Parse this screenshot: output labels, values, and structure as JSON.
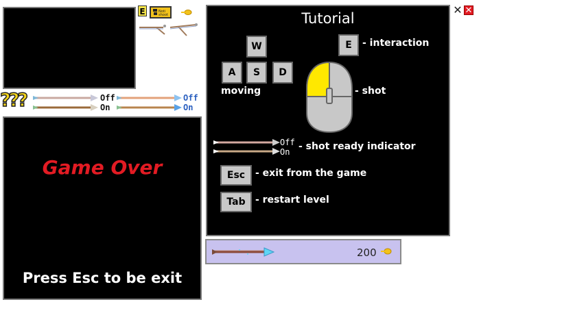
{
  "sprites": {
    "key_e": "E",
    "noti_sprite_text": "Noti\nshoot",
    "question_marks": "???",
    "indicator_labels": {
      "left_off": "Off",
      "left_on": "On",
      "right_off": "Off",
      "right_on": "On"
    }
  },
  "game_over": {
    "title": "Game Over",
    "hint": "Press Esc to be exit",
    "title_color": "#e21b23"
  },
  "tutorial": {
    "title": "Tutorial",
    "keys": {
      "w": "W",
      "a": "A",
      "s": "S",
      "d": "D",
      "e": "E",
      "esc": "Esc",
      "tab": "Tab"
    },
    "moving_label": "moving",
    "interaction_label": "- interaction",
    "shot_label": "- shot",
    "indicator_off": "Off",
    "indicator_on": "On",
    "indicator_label": "- shot ready indicator",
    "esc_label": "- exit from the game",
    "tab_label": "- restart level",
    "mouse_highlight_color": "#ffe800"
  },
  "hud": {
    "score": "200",
    "coin_icon": "coin-icon"
  },
  "window_controls": {
    "close_dark": "✕",
    "close_red": "✕"
  }
}
